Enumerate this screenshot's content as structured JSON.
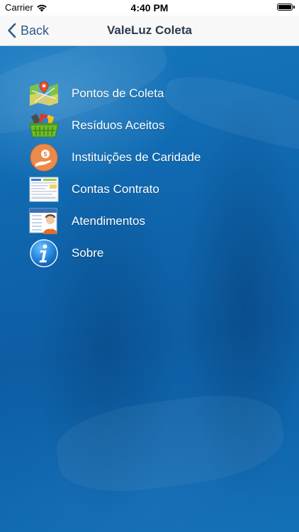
{
  "status_bar": {
    "carrier": "Carrier",
    "time": "4:40 PM",
    "battery_level": 1.0
  },
  "nav": {
    "back_label": "Back",
    "title": "ValeLuz Coleta"
  },
  "menu": {
    "items": [
      {
        "label": "Pontos de Coleta",
        "icon": "map-pin-icon"
      },
      {
        "label": "Resíduos Aceitos",
        "icon": "recycle-basket-icon"
      },
      {
        "label": "Instituições de Caridade",
        "icon": "charity-hand-coin-icon"
      },
      {
        "label": "Contas Contrato",
        "icon": "bill-document-icon"
      },
      {
        "label": "Atendimentos",
        "icon": "customer-service-icon"
      },
      {
        "label": "Sobre",
        "icon": "info-icon"
      }
    ]
  },
  "colors": {
    "background_blue": "#0f66ad",
    "nav_tint": "#2d5b8a",
    "nav_title": "#2b3a4e",
    "menu_text": "#ffffff"
  }
}
